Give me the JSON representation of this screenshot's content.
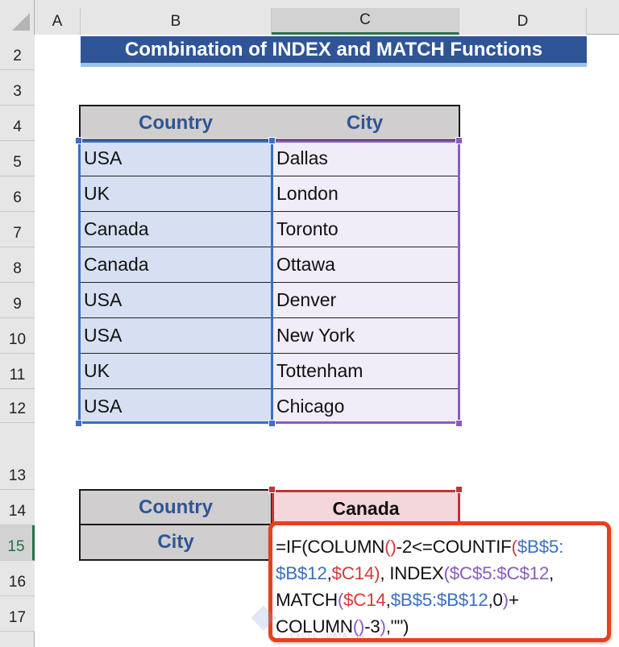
{
  "sheet": {
    "columns": [
      "A",
      "B",
      "C",
      "D"
    ],
    "selected_column": "C",
    "rows": [
      "2",
      "3",
      "4",
      "5",
      "6",
      "7",
      "8",
      "9",
      "10",
      "11",
      "12",
      "13",
      "14",
      "15",
      "16",
      "17"
    ],
    "selected_row": "15"
  },
  "title": "Combination of INDEX and MATCH Functions",
  "table": {
    "headers": [
      "Country",
      "City"
    ],
    "rows": [
      {
        "country": "USA",
        "city": "Dallas"
      },
      {
        "country": "UK",
        "city": "London"
      },
      {
        "country": "Canada",
        "city": "Toronto"
      },
      {
        "country": "Canada",
        "city": "Ottawa"
      },
      {
        "country": "USA",
        "city": "Denver"
      },
      {
        "country": "USA",
        "city": "New York"
      },
      {
        "country": "UK",
        "city": "Tottenham"
      },
      {
        "country": "USA",
        "city": "Chicago"
      }
    ]
  },
  "lookup": {
    "country_label": "Country",
    "city_label": "City",
    "country_value": "Canada"
  },
  "formula": {
    "segments": [
      {
        "text": "=IF(COLUMN",
        "color": "black"
      },
      {
        "text": "()",
        "color": "red"
      },
      {
        "text": "-2<=COUNTIF",
        "color": "black"
      },
      {
        "text": "(",
        "color": "purple"
      },
      {
        "text": "$B$5:",
        "color": "blue"
      },
      {
        "text": "$B$12",
        "color": "blue"
      },
      {
        "text": ",",
        "color": "black"
      },
      {
        "text": "$C14",
        "color": "red"
      },
      {
        "text": ")",
        "color": "purple"
      },
      {
        "text": ", INDEX",
        "color": "black"
      },
      {
        "text": "(",
        "color": "purple"
      },
      {
        "text": "$C$5:$C$12",
        "color": "purple"
      },
      {
        "text": ",",
        "color": "black"
      },
      {
        "text": "MATCH",
        "color": "black"
      },
      {
        "text": "(",
        "color": "purple"
      },
      {
        "text": "$C14",
        "color": "red"
      },
      {
        "text": ",",
        "color": "black"
      },
      {
        "text": "$B$5:$B$12",
        "color": "blue"
      },
      {
        "text": ",0",
        "color": "black"
      },
      {
        "text": ")",
        "color": "purple"
      },
      {
        "text": "+",
        "color": "black"
      },
      {
        "text": "COLUMN",
        "color": "black"
      },
      {
        "text": "()",
        "color": "purple"
      },
      {
        "text": "-3",
        "color": "black"
      },
      {
        "text": ")",
        "color": "red"
      },
      {
        "text": ",\"\")",
        "color": "black"
      }
    ],
    "lines": [
      [
        {
          "text": "=IF(COLUMN",
          "color": "black"
        },
        {
          "text": "()",
          "color": "red"
        },
        {
          "text": "-2<=COUNTIF",
          "color": "black"
        },
        {
          "text": "(",
          "color": "red"
        },
        {
          "text": "$B$5:",
          "color": "blue"
        }
      ],
      [
        {
          "text": "$B$12",
          "color": "blue"
        },
        {
          "text": ",",
          "color": "black"
        },
        {
          "text": "$C14",
          "color": "red"
        },
        {
          "text": ")",
          "color": "red"
        },
        {
          "text": ", INDEX",
          "color": "black"
        },
        {
          "text": "(",
          "color": "purple"
        },
        {
          "text": "$C$5:$C$12",
          "color": "purple"
        },
        {
          "text": ",",
          "color": "black"
        }
      ],
      [
        {
          "text": "MATCH",
          "color": "black"
        },
        {
          "text": "(",
          "color": "purple"
        },
        {
          "text": "$C14",
          "color": "red"
        },
        {
          "text": ",",
          "color": "black"
        },
        {
          "text": "$B$5:$B$12",
          "color": "blue"
        },
        {
          "text": ",0",
          "color": "black"
        },
        {
          "text": ")",
          "color": "purple"
        },
        {
          "text": "+",
          "color": "black"
        }
      ],
      [
        {
          "text": "COLUMN",
          "color": "black"
        },
        {
          "text": "()",
          "color": "purple"
        },
        {
          "text": "-3",
          "color": "black"
        },
        {
          "text": ")",
          "color": "purple"
        },
        {
          "text": ",\"\")",
          "color": "black"
        }
      ]
    ]
  },
  "colors": {
    "title_bg": "#2f5597",
    "header_bg": "#d0cece",
    "header_text": "#2f5597",
    "country_range": "#3a6fc4",
    "city_range": "#8a5cc0",
    "result_range": "#c0343c",
    "callout_border": "#e8401c"
  },
  "watermark": {
    "tagline": "EXCEL · DATA · BI"
  }
}
